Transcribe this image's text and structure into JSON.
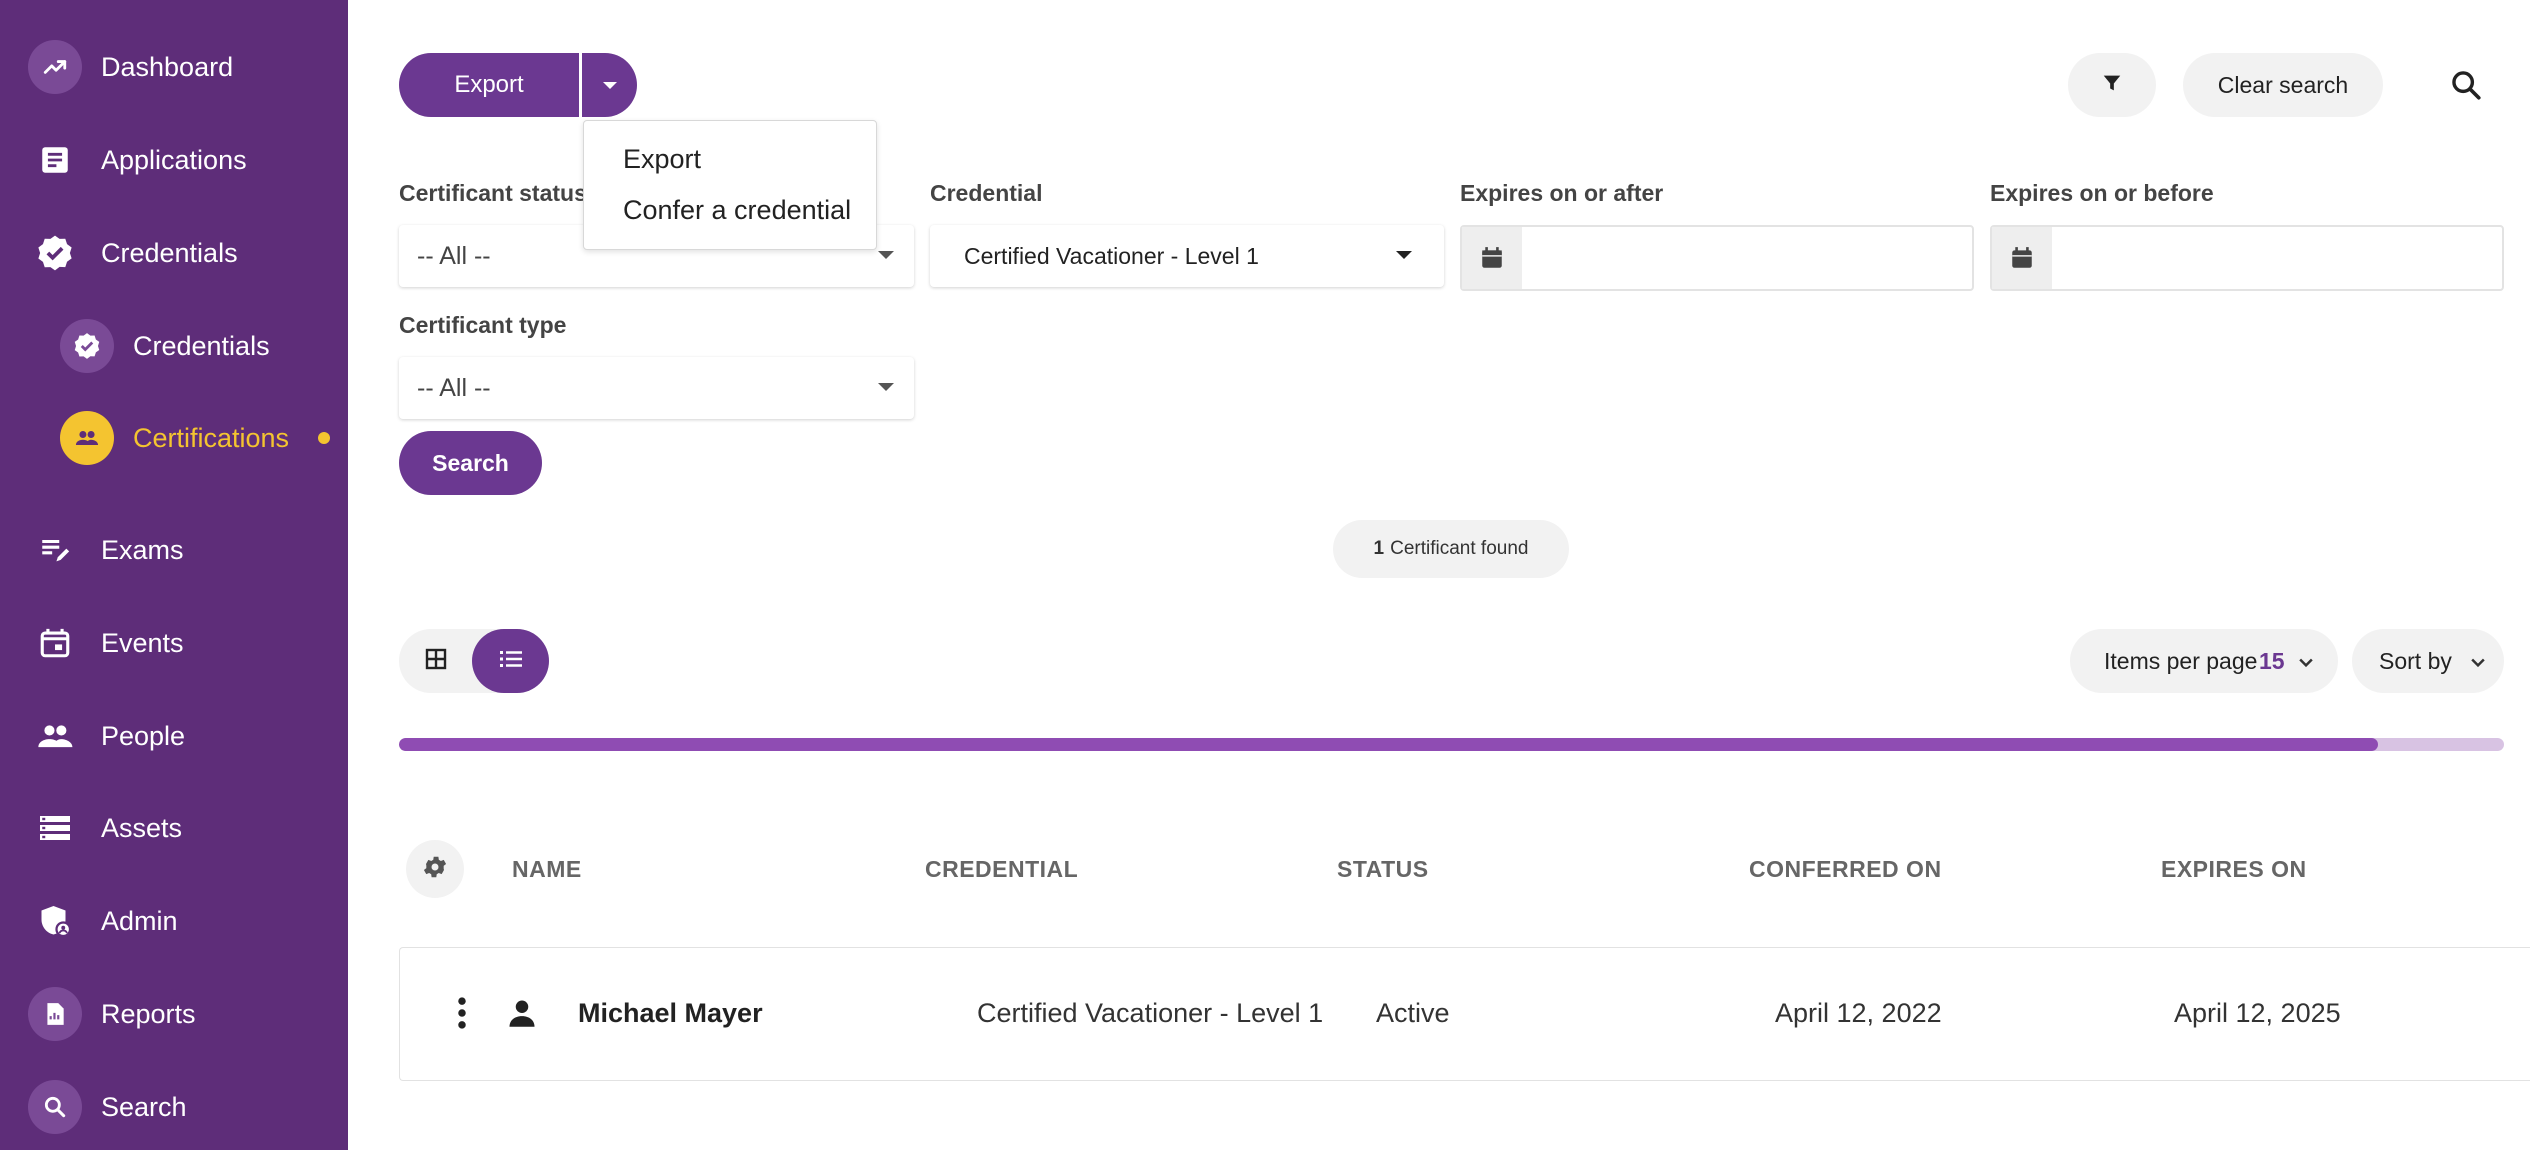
{
  "sidebar": {
    "items": [
      {
        "label": "Dashboard",
        "icon": "trending-up-icon"
      },
      {
        "label": "Applications",
        "icon": "document-icon"
      },
      {
        "label": "Credentials",
        "icon": "verified-badge-icon"
      },
      {
        "label": "Credentials",
        "icon": "verified-badge-icon"
      },
      {
        "label": "Certifications",
        "icon": "people-icon"
      },
      {
        "label": "Exams",
        "icon": "edit-list-icon"
      },
      {
        "label": "Events",
        "icon": "calendar-icon"
      },
      {
        "label": "People",
        "icon": "people-icon"
      },
      {
        "label": "Assets",
        "icon": "storage-icon"
      },
      {
        "label": "Admin",
        "icon": "admin-shield-icon"
      },
      {
        "label": "Reports",
        "icon": "report-icon"
      },
      {
        "label": "Search",
        "icon": "search-icon"
      }
    ]
  },
  "toolbar": {
    "export_label": "Export",
    "clear_search_label": "Clear search"
  },
  "export_menu": {
    "items": [
      "Export",
      "Confer a credential"
    ]
  },
  "filters": {
    "certificant_status": {
      "label": "Certificant status",
      "value": "-- All --"
    },
    "credential": {
      "label": "Credential",
      "value": "Certified Vacationer - Level 1"
    },
    "expires_after": {
      "label": "Expires on or after",
      "value": ""
    },
    "expires_before": {
      "label": "Expires on or before",
      "value": ""
    },
    "certificant_type": {
      "label": "Certificant type",
      "value": "-- All --"
    },
    "search_label": "Search"
  },
  "results": {
    "count": "1",
    "count_text": "Certificant found"
  },
  "list_controls": {
    "items_per_page_label": "Items per page",
    "items_per_page_value": "15",
    "sort_by_label": "Sort by",
    "progress_fraction": 0.94
  },
  "table": {
    "headers": [
      "NAME",
      "CREDENTIAL",
      "STATUS",
      "CONFERRED ON",
      "EXPIRES ON"
    ],
    "rows": [
      {
        "name": "Michael Mayer",
        "credential": "Certified Vacationer - Level 1",
        "status": "Active",
        "conferred_on": "April 12, 2022",
        "expires_on": "April 12, 2025"
      }
    ]
  },
  "colors": {
    "sidebar_bg": "#5e2d79",
    "accent": "#6b3891",
    "active": "#f4c430"
  }
}
